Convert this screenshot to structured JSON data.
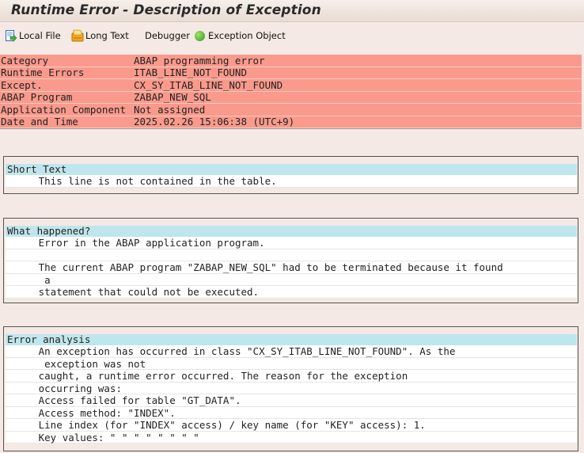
{
  "window": {
    "title": "Runtime Error - Description of Exception"
  },
  "toolbar": {
    "local_file": "Local File",
    "long_text": "Long Text",
    "debugger": "Debugger",
    "exception_object": "Exception Object"
  },
  "header": {
    "rows": [
      {
        "label": "Category",
        "value": "ABAP programming error"
      },
      {
        "label": "Runtime Errors",
        "value": "ITAB_LINE_NOT_FOUND"
      },
      {
        "label": "Except.",
        "value": "CX_SY_ITAB_LINE_NOT_FOUND"
      },
      {
        "label": "ABAP Program",
        "value": "ZABAP_NEW_SQL"
      },
      {
        "label": "Application Component",
        "value": "Not assigned"
      },
      {
        "label": "Date and Time",
        "value": "2025.02.26 15:06:38 (UTC+9)"
      }
    ]
  },
  "short_text": {
    "heading": "Short Text",
    "lines": [
      "     This line is not contained in the table."
    ]
  },
  "what_happened": {
    "heading": "What happened?",
    "lines": [
      "     Error in the ABAP application program.",
      "",
      "     The current ABAP program \"ZABAP_NEW_SQL\" had to be terminated because it found",
      "      a",
      "     statement that could not be executed."
    ]
  },
  "error_analysis": {
    "heading": "Error analysis",
    "lines": [
      "     An exception has occurred in class \"CX_SY_ITAB_LINE_NOT_FOUND\". As the",
      "      exception was not",
      "     caught, a runtime error occurred. The reason for the exception",
      "     occurring was:",
      "     Access failed for table \"GT_DATA\".",
      "     Access method: \"INDEX\".",
      "     Line index (for \"INDEX\" access) / key name (for \"KEY\" access): 1.",
      "     Key values: \" \" \" \" \" \" \" \""
    ]
  },
  "colors": {
    "header_row_bg": "#f99a8c",
    "section_heading_bg": "#bfe6ec",
    "page_bg": "#f4e9e4",
    "exception_icon": "#3aa82a"
  },
  "icons": {
    "local_file": "local-file-icon",
    "long_text": "long-text-icon",
    "exception_object": "exception-object-icon"
  }
}
